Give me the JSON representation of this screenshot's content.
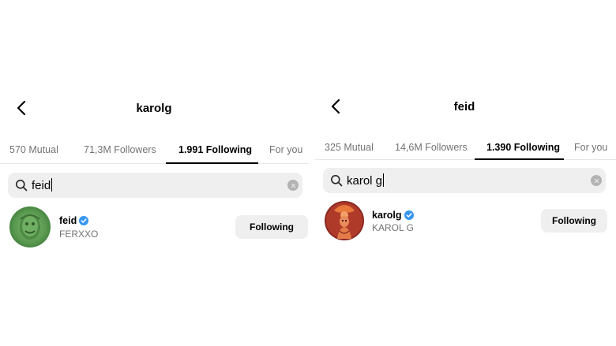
{
  "left": {
    "title": "karolg",
    "tabs": [
      {
        "label": "570 Mutual"
      },
      {
        "label": "71,3M Followers"
      },
      {
        "label": "1.991 Following"
      },
      {
        "label": "For you"
      }
    ],
    "search": {
      "value": "feid"
    },
    "result": {
      "username": "feid",
      "fullname": "FERXXO",
      "button": "Following"
    }
  },
  "right": {
    "title": "feid",
    "tabs": [
      {
        "label": "325 Mutual"
      },
      {
        "label": "14,6M Followers"
      },
      {
        "label": "1.390 Following"
      },
      {
        "label": "For you"
      }
    ],
    "search": {
      "value": "karol g"
    },
    "result": {
      "username": "karolg",
      "fullname": "KAROL G",
      "button": "Following"
    }
  },
  "icons": {
    "back": "chevron-left-icon",
    "search": "search-icon",
    "clear": "clear-icon",
    "verified": "verified-badge-icon"
  },
  "colors": {
    "verified": "#3797f0",
    "button_bg": "#efefef",
    "search_bg": "#efefef",
    "muted_text": "#737373"
  }
}
